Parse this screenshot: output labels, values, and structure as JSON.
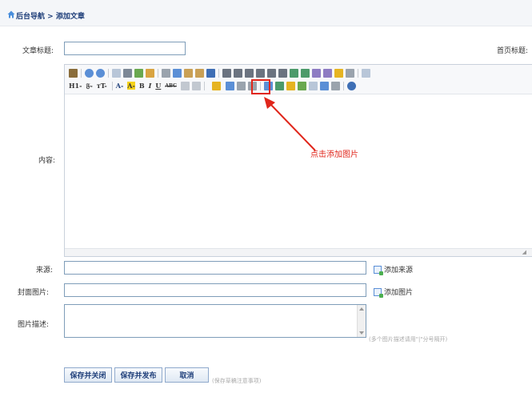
{
  "breadcrumb": {
    "root": "后台导航",
    "separator": ">",
    "current": "添加文章"
  },
  "form": {
    "title_label": "文章标题:",
    "home_title_label": "首页标题:",
    "content_label": "内容:",
    "source_label": "来源:",
    "cover_label": "封面图片:",
    "desc_label": "图片描述:",
    "title_value": "",
    "source_value": "",
    "cover_value": "",
    "desc_value": ""
  },
  "editor": {
    "row2_items": [
      "H1-",
      "𝔉-",
      "тT-",
      "A-",
      "A-",
      "B",
      "I",
      "U",
      "ABC"
    ],
    "annotation": "点击添加图片"
  },
  "links": {
    "add_source": "添加来源",
    "add_image": "添加图片"
  },
  "hints": {
    "desc_hint": "(多个图片描述请用\"|\"分号隔开)",
    "save_hint": "(保存草稿注意事项)"
  },
  "buttons": {
    "save_close": "保存并关闭",
    "save_publish": "保存并发布",
    "cancel": "取消"
  },
  "colors": {
    "accent": "#1f3f7a",
    "annotation": "#e0261b",
    "input_border": "#7f9db9"
  },
  "icons": {
    "toolbar_row1": [
      "source-icon",
      "undo-icon",
      "redo-icon",
      "preview-icon",
      "print-icon",
      "template-icon",
      "find-icon",
      "cut-icon",
      "copy-icon",
      "paste-icon",
      "paste-text-icon",
      "paste-word-icon",
      "align-left-icon",
      "align-center-icon",
      "align-right-icon",
      "justify-icon",
      "ordered-list-icon",
      "unordered-list-icon",
      "indent-icon",
      "outdent-icon",
      "subscript-icon",
      "superscript-icon",
      "clear-format-icon",
      "select-all-icon",
      "maximize-icon"
    ],
    "toolbar_row2": [
      "image-icon",
      "flash-icon",
      "media-icon",
      "table-icon",
      "hr-icon",
      "emoticon-icon",
      "special-char-icon",
      "pagebreak-icon",
      "anchor-icon",
      "link-icon",
      "unlink-icon",
      "about-icon"
    ]
  }
}
